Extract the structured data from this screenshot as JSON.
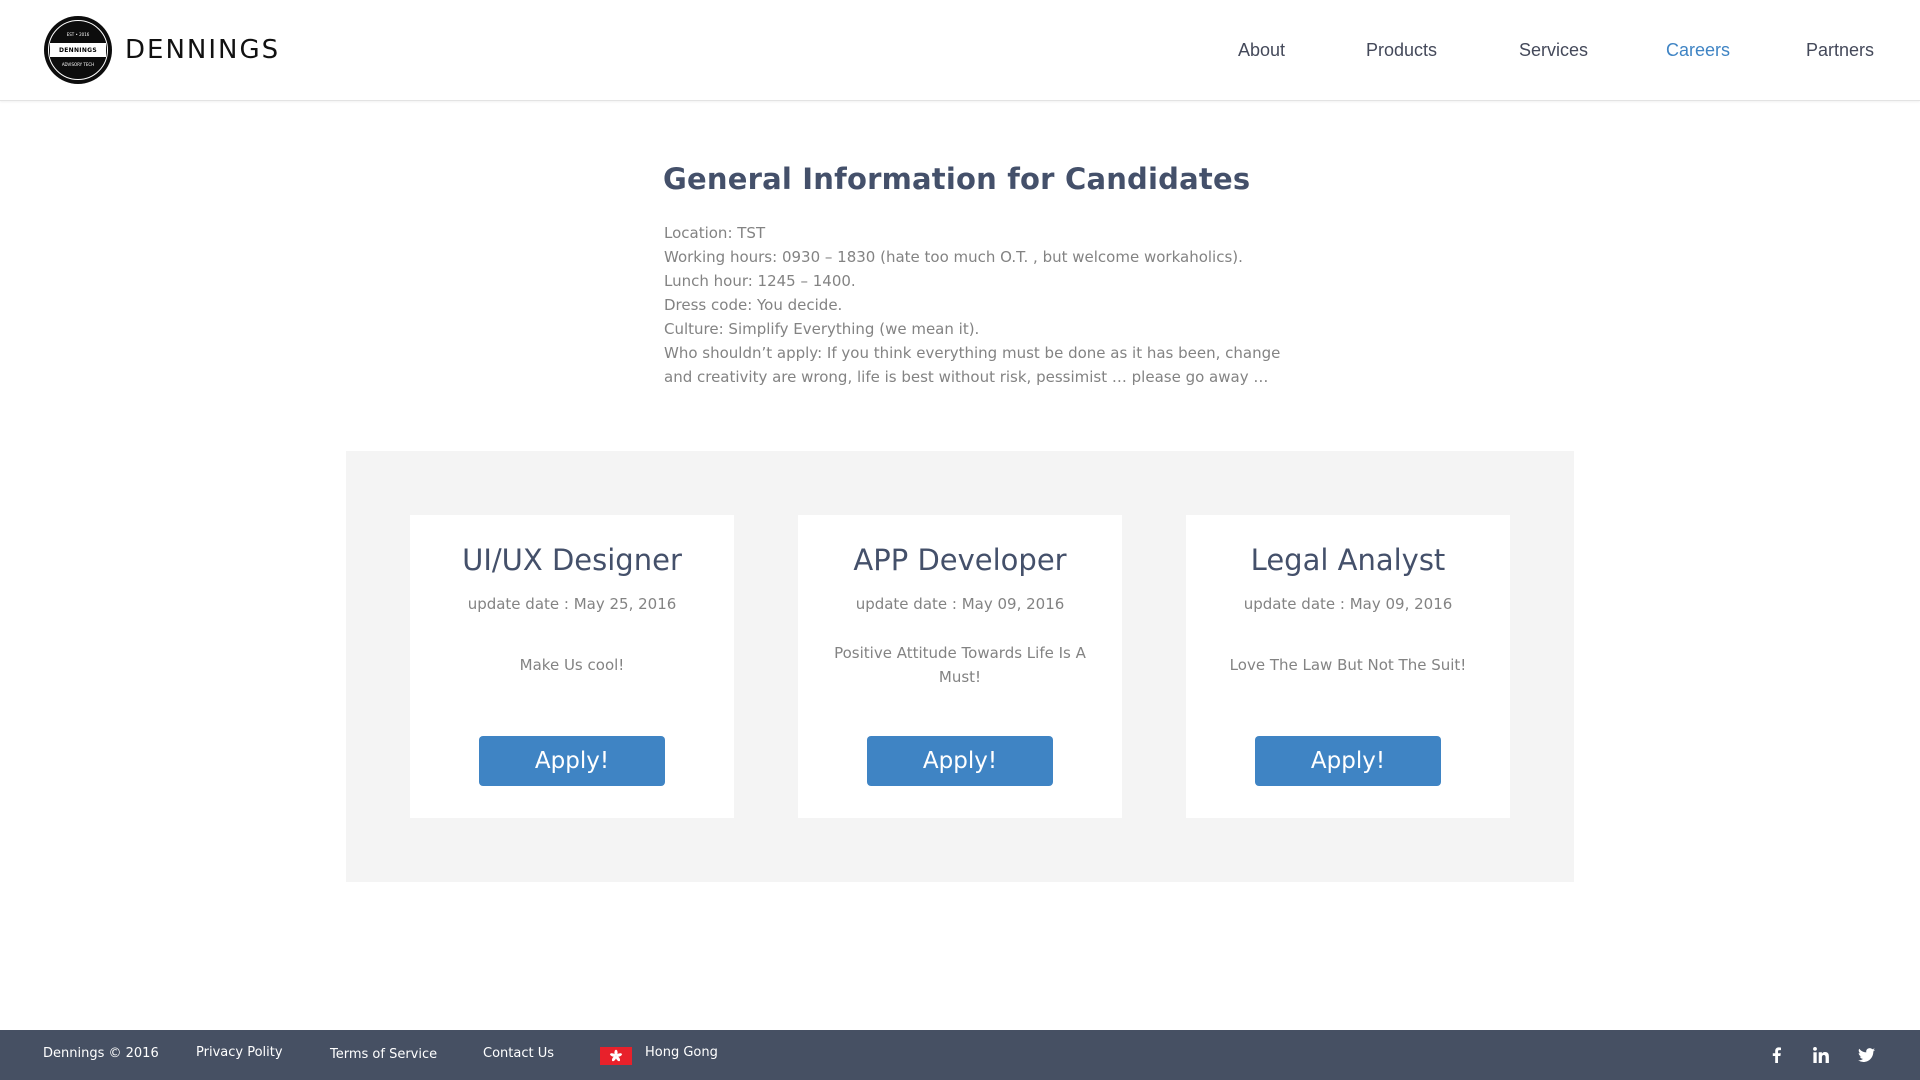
{
  "header": {
    "logo_text": "DENNINGS",
    "logo_badge": {
      "top": "EST • 2016",
      "band": "DENNINGS",
      "bottom": "ADVISORY TECH"
    },
    "nav": [
      {
        "label": "About",
        "active": false
      },
      {
        "label": "Products",
        "active": false
      },
      {
        "label": "Services",
        "active": false
      },
      {
        "label": "Careers",
        "active": true
      },
      {
        "label": "Partners",
        "active": false
      }
    ]
  },
  "info": {
    "title": "General Information for Candidates",
    "lines": [
      "Location: TST",
      "Working hours: 0930 – 1830 (hate too much O.T. , but welcome workaholics).",
      "Lunch hour: 1245 – 1400.",
      "Dress code: You decide.",
      "Culture: Simplify Everything (we mean it).",
      "Who shouldn’t apply: If you think everything must be done as it has been, change",
      "and creativity are wrong, life is best without risk, pessimist  … please go away …"
    ]
  },
  "jobs": [
    {
      "title": "UI/UX Designer",
      "date": "update date : May 25, 2016",
      "desc": "Make Us cool!",
      "button": "Apply!"
    },
    {
      "title": "APP Developer",
      "date": "update date : May 09, 2016",
      "desc": "Positive Attitude Towards Life Is A Must!",
      "button": "Apply!"
    },
    {
      "title": "Legal Analyst",
      "date": "update date : May 09, 2016",
      "desc": "Love The Law But Not The Suit!",
      "button": "Apply!"
    }
  ],
  "footer": {
    "copyright": "Dennings © 2016",
    "privacy": "Privacy Polity",
    "terms": "Terms of Service",
    "contact": "Contact Us",
    "region": "Hong Gong",
    "region_flag_icon": "hong-kong-flag-icon",
    "social_icons": [
      "facebook-icon",
      "linkedin-icon",
      "twitter-icon"
    ]
  },
  "colors": {
    "accent": "#3f84c4",
    "heading": "#44506a",
    "body_text": "#838383",
    "footer_bg": "#465063",
    "panel_bg": "#f4f4f4"
  }
}
